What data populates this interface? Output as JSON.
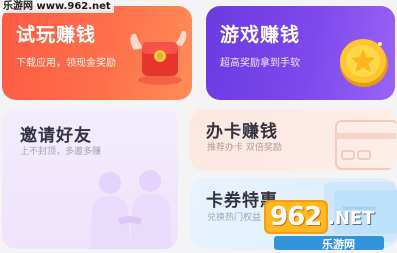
{
  "watermark": {
    "site": "乐游网 www.962.net",
    "logo_number": "962",
    "logo_suffix": ".NET",
    "logo_cn": "乐游网"
  },
  "cards": {
    "trial": {
      "title": "试玩赚钱",
      "subtitle": "下载应用，领现金奖励"
    },
    "game": {
      "title": "游戏赚钱",
      "subtitle": "超高奖励拿到手软"
    },
    "invite": {
      "title": "邀请好友",
      "subtitle": "上不封顶，多邀多赚"
    },
    "bankcard": {
      "title": "办卡赚钱",
      "subtitle": "推荐办卡 双倍奖励"
    },
    "coupon": {
      "title": "卡券特惠",
      "subtitle": "兑换热门权益"
    }
  },
  "colors": {
    "trial_bg": "#ff5b43",
    "game_bg": "#7e48ee",
    "invite_bg": "#f3ecfd",
    "bankcard_bg": "#fde7e1",
    "coupon_bg": "#e8f3fe"
  }
}
